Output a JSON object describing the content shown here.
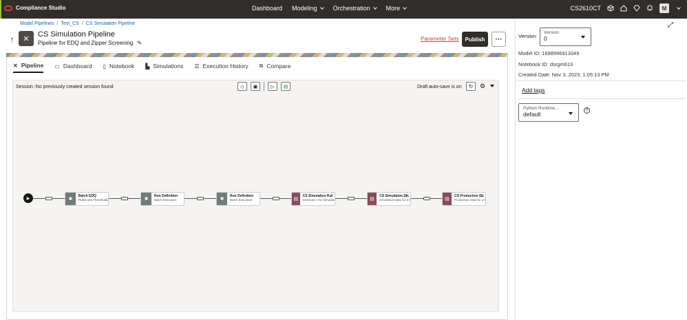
{
  "app": {
    "name": "Compliance Studio",
    "accent": "#8ec63f",
    "brand_color": "#c74634"
  },
  "nav": {
    "items": [
      {
        "label": "Dashboard",
        "dropdown": false
      },
      {
        "label": "Modeling",
        "dropdown": true
      },
      {
        "label": "Orchestration",
        "dropdown": true
      },
      {
        "label": "More",
        "dropdown": true
      }
    ]
  },
  "toolbar": {
    "tenant": "CS2610CT",
    "avatar": "M"
  },
  "breadcrumb": [
    "Model Pipelines",
    "Test_CS",
    "CS Simulation Pipeline"
  ],
  "header": {
    "title": "CS Simulation Pipeline",
    "subtitle": "Pipeline for EDQ and Zipper Screening",
    "param_sets": "Parameter Sets",
    "publish": "Publish"
  },
  "tabs": [
    {
      "label": "Pipeline",
      "icon": "pipeline-icon",
      "active": true
    },
    {
      "label": "Dashboard",
      "icon": "dashboard-icon",
      "active": false
    },
    {
      "label": "Notebook",
      "icon": "notebook-icon",
      "active": false
    },
    {
      "label": "Simulations",
      "icon": "chart-icon",
      "active": false
    },
    {
      "label": "Execution History",
      "icon": "history-icon",
      "active": false
    },
    {
      "label": "Compare",
      "icon": "compare-icon",
      "active": false
    }
  ],
  "canvas": {
    "session": "Session :No previously created session found",
    "autosave": "Draft auto-save is on"
  },
  "nodes": [
    {
      "title": "Batch EDQ",
      "desc": "Rules and Thresholds",
      "kind": "gray"
    },
    {
      "title": "Run Definition",
      "desc": "Batch Execution",
      "kind": "gray"
    },
    {
      "title": "Run Definition",
      "desc": "Batch Execution",
      "kind": "gray"
    },
    {
      "title": "CS Simulation R...",
      "desc": "Summary of a Simulation Run",
      "kind": "rose"
    },
    {
      "title": "CS Simulation D...",
      "desc": "Simulation Data for a Run",
      "kind": "rose"
    },
    {
      "title": "CS Production D...",
      "desc": "Production Data for a Run",
      "kind": "rose"
    }
  ],
  "side": {
    "version_label": "Version:",
    "version_field_label": "Version",
    "version_value": "0",
    "model_id": "Model ID: 1698996913349",
    "notebook_id": "Notebook ID: dsrgm613",
    "created": "Created Date: Nov 3, 2023, 1:05:13 PM",
    "add_tags": "Add tags",
    "python_label": "Python Runtime...",
    "python_value": "default"
  }
}
